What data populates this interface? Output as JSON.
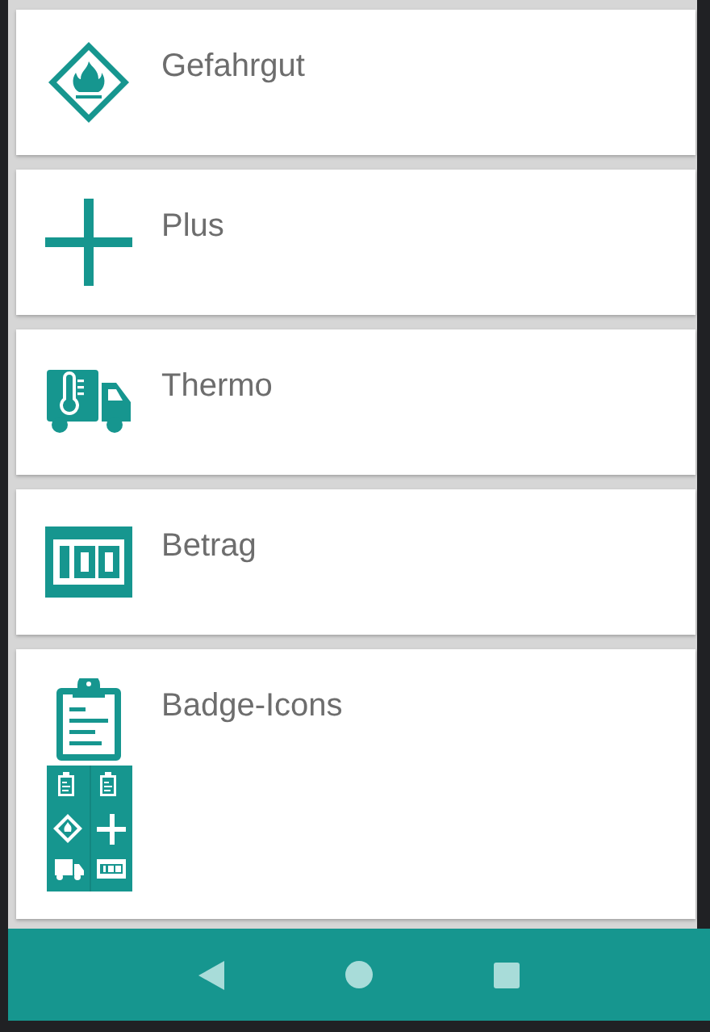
{
  "items": [
    {
      "kind": "hazard",
      "label": "Gefahrgut"
    },
    {
      "kind": "plus",
      "label": "Plus"
    },
    {
      "kind": "thermo",
      "label": "Thermo"
    },
    {
      "kind": "amount",
      "label": "Betrag"
    },
    {
      "kind": "badges",
      "label": "Badge-Icons"
    }
  ]
}
